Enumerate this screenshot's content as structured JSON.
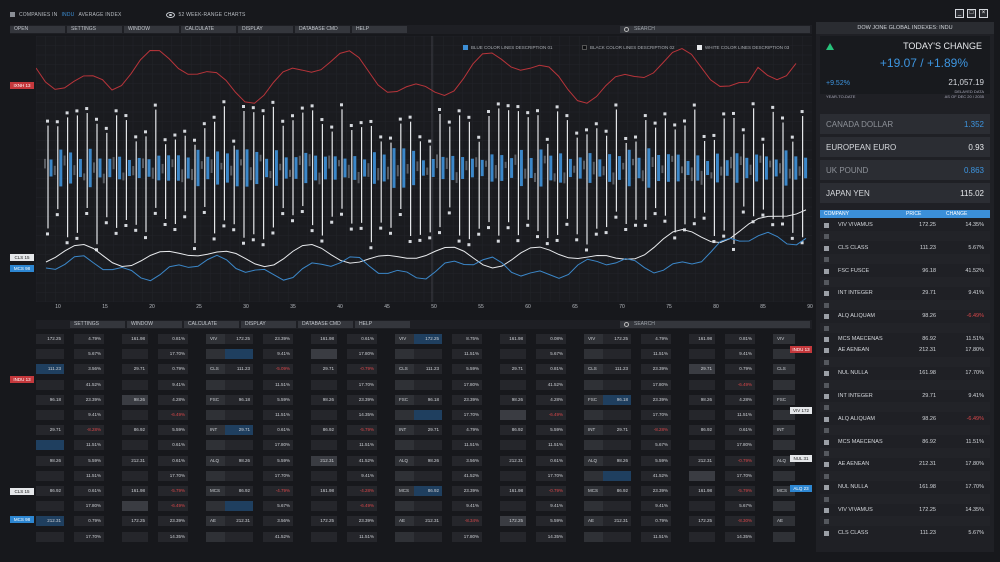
{
  "titlebar": {
    "seg1": "COMPANIES IN",
    "seg2": "INDU",
    "seg3": "AVERAGE INDEX",
    "seg4": "52 WEEK-RANGE CHARTS"
  },
  "menu_top": {
    "items": [
      "OPEN",
      "SETTINGS",
      "WINDOW",
      "CALCULATE",
      "DISPLAY",
      "DATABASE CMD",
      "HELP"
    ],
    "search": "SEARCH"
  },
  "menu_bottom": {
    "items": [
      "SETTINGS",
      "WINDOW",
      "CALCULATE",
      "DISPLAY",
      "DATABASE CMD",
      "HELP"
    ],
    "search": "SEARCH"
  },
  "legend": {
    "blue": "BLUE COLOR LINES DESCRIPTION 01",
    "black": "BLACK COLOR LINES DESCRIPTION 02",
    "white": "WHITE COLOR LINES DESCRIPTION 03"
  },
  "y_tags": {
    "red": "IXNH 13",
    "white": "CLS 15",
    "blue": "MCS 98"
  },
  "chart_data": {
    "type": "line",
    "x_ticks": [
      "10",
      "15",
      "20",
      "25",
      "30",
      "35",
      "40",
      "45",
      "50",
      "55",
      "60",
      "65",
      "70",
      "75",
      "80",
      "85",
      "90"
    ],
    "series": []
  },
  "dow": {
    "header": "DOW JONE GLOBAL INDEXES: INDU",
    "today_title": "TODAY'S CHANGE",
    "change": "+19.07 / +1.89%",
    "pct": "+9.52%",
    "index": "21,057.19",
    "delayed": "DELAYED DATA",
    "ytd": "YEAR-TO-DATE",
    "asof": "AS OF DEC 20 / 2035"
  },
  "fx": [
    {
      "name": "CANADA DOLLAR",
      "value": "1.352",
      "style": "dim blue"
    },
    {
      "name": "EUROPEAN EURO",
      "value": "0.93",
      "style": ""
    },
    {
      "name": "UK POUND",
      "value": "0.863",
      "style": "dim blue"
    },
    {
      "name": "JAPAN YEN",
      "value": "115.02",
      "style": ""
    }
  ],
  "companies": {
    "headers": {
      "company": "COMPANY",
      "price": "PRICE",
      "change": "CHANGE"
    },
    "rows": [
      {
        "c": "VIV VIVAMUS",
        "p": "172.25",
        "g": "14.35%",
        "t": ""
      },
      {
        "c": "",
        "p": "",
        "g": "",
        "t": "blank"
      },
      {
        "c": "CLS  CLASS",
        "p": "111.23",
        "g": "5.67%",
        "t": ""
      },
      {
        "c": "",
        "p": "",
        "g": "",
        "t": "blank"
      },
      {
        "c": "FSC  FUSCE",
        "p": "96.18",
        "g": "41.52%",
        "t": ""
      },
      {
        "c": "",
        "p": "",
        "g": "",
        "t": "blank"
      },
      {
        "c": "INT  INTEGER",
        "p": "29.71",
        "g": "9.41%",
        "t": ""
      },
      {
        "c": "",
        "p": "",
        "g": "",
        "t": "blank"
      },
      {
        "c": "ALQ  ALIQUAM",
        "p": "98.26",
        "g": "-6.49%",
        "t": "red"
      },
      {
        "c": "",
        "p": "",
        "g": "",
        "t": "blank"
      },
      {
        "c": "MCS  MAECENAS",
        "p": "86.92",
        "g": "11.51%",
        "t": ""
      },
      {
        "c": "AE  AENEAN",
        "p": "212.31",
        "g": "17.80%",
        "t": ""
      },
      {
        "c": "",
        "p": "",
        "g": "",
        "t": "blank"
      },
      {
        "c": "NUL  NULLA",
        "p": "161.98",
        "g": "17.70%",
        "t": ""
      },
      {
        "c": "",
        "p": "",
        "g": "",
        "t": "blank"
      },
      {
        "c": "INT  INTEGER",
        "p": "29.71",
        "g": "9.41%",
        "t": ""
      },
      {
        "c": "",
        "p": "",
        "g": "",
        "t": "blank"
      },
      {
        "c": "ALQ  ALIQUAM",
        "p": "98.26",
        "g": "-6.49%",
        "t": ""
      },
      {
        "c": "",
        "p": "",
        "g": "",
        "t": "blank"
      },
      {
        "c": "MCS  MAECENAS",
        "p": "86.92",
        "g": "11.51%",
        "t": ""
      },
      {
        "c": "",
        "p": "",
        "g": "",
        "t": "blank"
      },
      {
        "c": "AE  AENEAN",
        "p": "212.31",
        "g": "17.80%",
        "t": ""
      },
      {
        "c": "",
        "p": "",
        "g": "",
        "t": "blank"
      },
      {
        "c": "NUL  NULLA",
        "p": "161.98",
        "g": "17.70%",
        "t": ""
      },
      {
        "c": "",
        "p": "",
        "g": "",
        "t": "blank"
      },
      {
        "c": "VIV VIVAMUS",
        "p": "172.25",
        "g": "14.35%",
        "t": ""
      },
      {
        "c": "",
        "p": "",
        "g": "",
        "t": "blank"
      },
      {
        "c": "CLS  CLASS",
        "p": "111.23",
        "g": "5.67%",
        "t": ""
      }
    ]
  },
  "table": {
    "blocks": [
      [
        [
          "172.25",
          "4.79%",
          "161.98",
          "0.81%",
          "VIV"
        ],
        [
          "",
          "5.67%",
          "",
          "17.70%",
          ""
        ],
        [
          "111.23",
          "3.56%",
          "29.71",
          "0.79%",
          "CLS"
        ],
        [
          "",
          "41.52%",
          "",
          "9.41%",
          ""
        ],
        [
          "96.18",
          "23.39%",
          "98.26",
          "4.28%",
          "FSC"
        ],
        [
          "",
          "9.41%",
          "",
          "-6.49%",
          ""
        ],
        [
          "29.71",
          "-8.28%",
          "86.92",
          "5.59%",
          "INT"
        ],
        [
          "",
          "11.51%",
          "",
          "0.61%",
          ""
        ],
        [
          "98.26",
          "5.59%",
          "212.31",
          "0.61%",
          "ALQ"
        ],
        [
          "",
          "11.51%",
          "",
          "17.70%",
          ""
        ],
        [
          "86.92",
          "0.61%",
          "161.98",
          "-5.79%",
          "MCS"
        ],
        [
          "",
          "17.80%",
          "",
          "-6.49%",
          ""
        ],
        [
          "212.31",
          "0.79%",
          "172.25",
          "23.39%",
          "AE"
        ],
        [
          "",
          "17.70%",
          "",
          "14.35%",
          ""
        ]
      ],
      [
        [
          "172.25",
          "23.39%",
          "161.98",
          "0.61%",
          "VIV"
        ],
        [
          "",
          "9.41%",
          "",
          "17.80%",
          ""
        ],
        [
          "111.23",
          "-5.09%",
          "29.71",
          "-0.79%",
          "CLS"
        ],
        [
          "",
          "11.51%",
          "",
          "17.70%",
          ""
        ],
        [
          "96.18",
          "5.59%",
          "98.26",
          "23.39%",
          "FSC"
        ],
        [
          "",
          "11.51%",
          "",
          "14.35%",
          ""
        ],
        [
          "29.71",
          "0.61%",
          "86.92",
          "-5.79%",
          "INT"
        ],
        [
          "",
          "17.80%",
          "",
          "11.51%",
          ""
        ],
        [
          "98.26",
          "5.59%",
          "212.31",
          "41.52%",
          "ALQ"
        ],
        [
          "",
          "17.70%",
          "",
          "9.41%",
          ""
        ],
        [
          "86.92",
          "-4.79%",
          "161.98",
          "-4.28%",
          "MCS"
        ],
        [
          "",
          "5.67%",
          "",
          "-6.49%",
          ""
        ],
        [
          "212.31",
          "3.56%",
          "172.25",
          "23.39%",
          "AE"
        ],
        [
          "",
          "41.52%",
          "",
          "11.51%",
          ""
        ]
      ],
      [
        [
          "172.25",
          "8.75%",
          "161.98",
          "0.08%",
          "VIV"
        ],
        [
          "",
          "11.51%",
          "",
          "5.67%",
          ""
        ],
        [
          "111.23",
          "5.59%",
          "29.71",
          "0.81%",
          "CLS"
        ],
        [
          "",
          "17.80%",
          "",
          "41.52%",
          ""
        ],
        [
          "96.18",
          "23.39%",
          "98.26",
          "4.28%",
          "FSC"
        ],
        [
          "",
          "17.70%",
          "",
          "-6.49%",
          ""
        ],
        [
          "29.71",
          "4.79%",
          "86.92",
          "5.59%",
          "INT"
        ],
        [
          "",
          "11.51%",
          "",
          "11.51%",
          ""
        ],
        [
          "98.26",
          "3.56%",
          "212.31",
          "0.61%",
          "ALQ"
        ],
        [
          "",
          "41.52%",
          "",
          "17.70%",
          ""
        ],
        [
          "86.92",
          "23.39%",
          "161.98",
          "-0.79%",
          "MCS"
        ],
        [
          "",
          "9.41%",
          "",
          "9.41%",
          ""
        ],
        [
          "212.31",
          "-8.34%",
          "172.25",
          "5.59%",
          "AE"
        ],
        [
          "",
          "17.80%",
          "",
          "14.35%",
          ""
        ]
      ],
      [
        [
          "172.25",
          "4.79%",
          "161.98",
          "0.81%",
          "VIV"
        ],
        [
          "",
          "11.51%",
          "",
          "9.41%",
          ""
        ],
        [
          "111.23",
          "23.39%",
          "29.71",
          "0.79%",
          "CLS"
        ],
        [
          "",
          "17.80%",
          "",
          "-6.49%",
          ""
        ],
        [
          "96.18",
          "23.39%",
          "98.26",
          "4.28%",
          "FSC"
        ],
        [
          "",
          "17.70%",
          "",
          "11.51%",
          ""
        ],
        [
          "29.71",
          "-8.28%",
          "86.92",
          "0.61%",
          "INT"
        ],
        [
          "",
          "5.67%",
          "",
          "17.80%",
          ""
        ],
        [
          "98.26",
          "5.59%",
          "212.31",
          "-0.79%",
          "ALQ"
        ],
        [
          "",
          "41.52%",
          "",
          "17.70%",
          ""
        ],
        [
          "86.92",
          "23.39%",
          "161.98",
          "-5.79%",
          "MCS"
        ],
        [
          "",
          "9.41%",
          "",
          "5.67%",
          ""
        ],
        [
          "212.31",
          "0.79%",
          "172.25",
          "-8.30%",
          "AE"
        ],
        [
          "",
          "11.51%",
          "",
          "14.35%",
          ""
        ]
      ]
    ]
  },
  "table_tags": {
    "left": [
      "INDU 13",
      "CLS 15",
      "MCS 98"
    ],
    "right": [
      "INDU 13",
      "VIV 172",
      "NUL 31",
      "ALQ 23"
    ]
  }
}
